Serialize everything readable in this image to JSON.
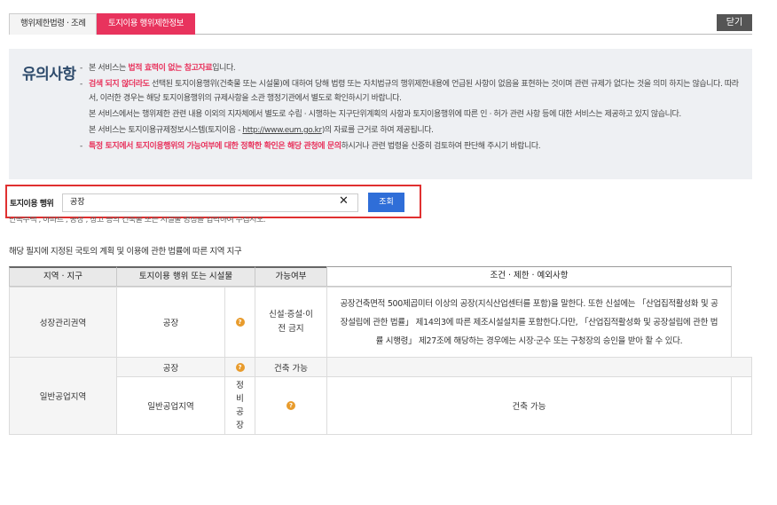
{
  "tabs": [
    {
      "label": "행위제한법령 · 조례",
      "active": false
    },
    {
      "label": "토지이용 행위제한정보",
      "active": true
    }
  ],
  "close_button": "닫기",
  "notice": {
    "title": "유의사항",
    "bullet": "-",
    "line1_pre": "본 서비스는 ",
    "line1_red": "법적 효력이 없는 참고자료",
    "line1_post": "입니다.",
    "line2_red": "검색 되지 않더라도",
    "line2_post": " 선택된 토지이용행위(건축물 또는 시설물)에 대하여 당해 법령 또는 자치법규의 행위제한내용에 언급된 사항이 없음을 표현하는 것이며 관련 규제가 없다는 것을 의미 하지는 않습니다. 따라서, 이러한 경우는 해당 토지이용행위의 규제사항을 소관 행정기관에서 별도로 확인하시기 바랍니다.",
    "line3": "본 서비스에서는 행위제한 관련 내용 이외의 지자체에서 별도로 수립 · 시행하는 지구단위계획의 사항과 토지이용행위에 따른 인 · 허가 관련 사항 등에 대한 서비스는 제공하고 있지 않습니다.",
    "line4_pre": "본 서비스는 토지이용규제정보시스템(토지이음 - ",
    "line4_link": "http://www.eum.go.kr",
    "line4_post": ")의 자료를 근거로 하여 제공됩니다.",
    "line5_red": "특정 토지에서 토지이용행위의 가능여부에 대한 정확한 확인은 해당 관청에 문의",
    "line5_post": "하시거나 관련 법령을 신중히 검토하여 판단해 주시기 바랍니다."
  },
  "search": {
    "label": "토지이용 행위",
    "value": "공장",
    "clear": "✕",
    "button": "조회",
    "hint": "단독주택 , 아파트 , 공장 , 창고 등의 건축물 또는 시설물 명칭을 입력하여 주십시오."
  },
  "description": "해당 필지에 지정된 국토의 계획 및 이용에 관한 법률에 따른 지역 지구",
  "table": {
    "headers": [
      "지역 · 지구",
      "토지이용 행위 또는 시설물",
      "가능여부",
      "조건 · 제한 · 예외사항"
    ],
    "q_icon": "?",
    "row1": {
      "zone": "성장관리권역",
      "facility": "공장",
      "availability": "신설·증설·이전 금지",
      "condition": "공장건축면적 500제곱미터 이상의 공장(지식산업센터를 포함)을 말한다. 또한 신설에는 「산업집적활성화 및 공장설립에 관한 법률」 제14의3에 따른 제조시설설치를 포함한다.다만, 「산업집적활성화 및 공장설립에 관한 법률 시행령」 제27조에 해당하는 경우에는 시장·군수 또는 구청장의 승인을 받아 할 수 있다."
    },
    "row2": {
      "zone": "일반공업지역",
      "facility": "공장",
      "availability": "건축 가능"
    },
    "row3": {
      "facility": "일반공업지역",
      "sub": "정비공장",
      "availability": "건축 가능"
    }
  }
}
